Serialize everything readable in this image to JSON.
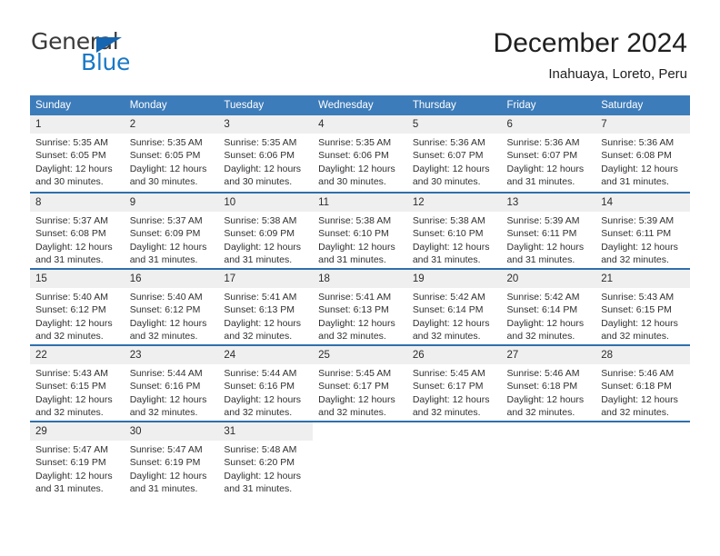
{
  "brand": {
    "name_top": "General",
    "name_bottom": "Blue",
    "flag_color": "#1565b0",
    "text_color": "#3a3a3a",
    "blue_color": "#1878c6"
  },
  "header": {
    "title": "December 2024",
    "location": "Inahuaya, Loreto, Peru"
  },
  "theme": {
    "header_row_bg": "#3d7cba",
    "day_number_bg": "#efefef",
    "row_divider": "#2f6fad"
  },
  "weekdays": [
    "Sunday",
    "Monday",
    "Tuesday",
    "Wednesday",
    "Thursday",
    "Friday",
    "Saturday"
  ],
  "weeks": [
    [
      {
        "day": "1",
        "sunrise": "Sunrise: 5:35 AM",
        "sunset": "Sunset: 6:05 PM",
        "daylight1": "Daylight: 12 hours",
        "daylight2": "and 30 minutes."
      },
      {
        "day": "2",
        "sunrise": "Sunrise: 5:35 AM",
        "sunset": "Sunset: 6:05 PM",
        "daylight1": "Daylight: 12 hours",
        "daylight2": "and 30 minutes."
      },
      {
        "day": "3",
        "sunrise": "Sunrise: 5:35 AM",
        "sunset": "Sunset: 6:06 PM",
        "daylight1": "Daylight: 12 hours",
        "daylight2": "and 30 minutes."
      },
      {
        "day": "4",
        "sunrise": "Sunrise: 5:35 AM",
        "sunset": "Sunset: 6:06 PM",
        "daylight1": "Daylight: 12 hours",
        "daylight2": "and 30 minutes."
      },
      {
        "day": "5",
        "sunrise": "Sunrise: 5:36 AM",
        "sunset": "Sunset: 6:07 PM",
        "daylight1": "Daylight: 12 hours",
        "daylight2": "and 30 minutes."
      },
      {
        "day": "6",
        "sunrise": "Sunrise: 5:36 AM",
        "sunset": "Sunset: 6:07 PM",
        "daylight1": "Daylight: 12 hours",
        "daylight2": "and 31 minutes."
      },
      {
        "day": "7",
        "sunrise": "Sunrise: 5:36 AM",
        "sunset": "Sunset: 6:08 PM",
        "daylight1": "Daylight: 12 hours",
        "daylight2": "and 31 minutes."
      }
    ],
    [
      {
        "day": "8",
        "sunrise": "Sunrise: 5:37 AM",
        "sunset": "Sunset: 6:08 PM",
        "daylight1": "Daylight: 12 hours",
        "daylight2": "and 31 minutes."
      },
      {
        "day": "9",
        "sunrise": "Sunrise: 5:37 AM",
        "sunset": "Sunset: 6:09 PM",
        "daylight1": "Daylight: 12 hours",
        "daylight2": "and 31 minutes."
      },
      {
        "day": "10",
        "sunrise": "Sunrise: 5:38 AM",
        "sunset": "Sunset: 6:09 PM",
        "daylight1": "Daylight: 12 hours",
        "daylight2": "and 31 minutes."
      },
      {
        "day": "11",
        "sunrise": "Sunrise: 5:38 AM",
        "sunset": "Sunset: 6:10 PM",
        "daylight1": "Daylight: 12 hours",
        "daylight2": "and 31 minutes."
      },
      {
        "day": "12",
        "sunrise": "Sunrise: 5:38 AM",
        "sunset": "Sunset: 6:10 PM",
        "daylight1": "Daylight: 12 hours",
        "daylight2": "and 31 minutes."
      },
      {
        "day": "13",
        "sunrise": "Sunrise: 5:39 AM",
        "sunset": "Sunset: 6:11 PM",
        "daylight1": "Daylight: 12 hours",
        "daylight2": "and 31 minutes."
      },
      {
        "day": "14",
        "sunrise": "Sunrise: 5:39 AM",
        "sunset": "Sunset: 6:11 PM",
        "daylight1": "Daylight: 12 hours",
        "daylight2": "and 32 minutes."
      }
    ],
    [
      {
        "day": "15",
        "sunrise": "Sunrise: 5:40 AM",
        "sunset": "Sunset: 6:12 PM",
        "daylight1": "Daylight: 12 hours",
        "daylight2": "and 32 minutes."
      },
      {
        "day": "16",
        "sunrise": "Sunrise: 5:40 AM",
        "sunset": "Sunset: 6:12 PM",
        "daylight1": "Daylight: 12 hours",
        "daylight2": "and 32 minutes."
      },
      {
        "day": "17",
        "sunrise": "Sunrise: 5:41 AM",
        "sunset": "Sunset: 6:13 PM",
        "daylight1": "Daylight: 12 hours",
        "daylight2": "and 32 minutes."
      },
      {
        "day": "18",
        "sunrise": "Sunrise: 5:41 AM",
        "sunset": "Sunset: 6:13 PM",
        "daylight1": "Daylight: 12 hours",
        "daylight2": "and 32 minutes."
      },
      {
        "day": "19",
        "sunrise": "Sunrise: 5:42 AM",
        "sunset": "Sunset: 6:14 PM",
        "daylight1": "Daylight: 12 hours",
        "daylight2": "and 32 minutes."
      },
      {
        "day": "20",
        "sunrise": "Sunrise: 5:42 AM",
        "sunset": "Sunset: 6:14 PM",
        "daylight1": "Daylight: 12 hours",
        "daylight2": "and 32 minutes."
      },
      {
        "day": "21",
        "sunrise": "Sunrise: 5:43 AM",
        "sunset": "Sunset: 6:15 PM",
        "daylight1": "Daylight: 12 hours",
        "daylight2": "and 32 minutes."
      }
    ],
    [
      {
        "day": "22",
        "sunrise": "Sunrise: 5:43 AM",
        "sunset": "Sunset: 6:15 PM",
        "daylight1": "Daylight: 12 hours",
        "daylight2": "and 32 minutes."
      },
      {
        "day": "23",
        "sunrise": "Sunrise: 5:44 AM",
        "sunset": "Sunset: 6:16 PM",
        "daylight1": "Daylight: 12 hours",
        "daylight2": "and 32 minutes."
      },
      {
        "day": "24",
        "sunrise": "Sunrise: 5:44 AM",
        "sunset": "Sunset: 6:16 PM",
        "daylight1": "Daylight: 12 hours",
        "daylight2": "and 32 minutes."
      },
      {
        "day": "25",
        "sunrise": "Sunrise: 5:45 AM",
        "sunset": "Sunset: 6:17 PM",
        "daylight1": "Daylight: 12 hours",
        "daylight2": "and 32 minutes."
      },
      {
        "day": "26",
        "sunrise": "Sunrise: 5:45 AM",
        "sunset": "Sunset: 6:17 PM",
        "daylight1": "Daylight: 12 hours",
        "daylight2": "and 32 minutes."
      },
      {
        "day": "27",
        "sunrise": "Sunrise: 5:46 AM",
        "sunset": "Sunset: 6:18 PM",
        "daylight1": "Daylight: 12 hours",
        "daylight2": "and 32 minutes."
      },
      {
        "day": "28",
        "sunrise": "Sunrise: 5:46 AM",
        "sunset": "Sunset: 6:18 PM",
        "daylight1": "Daylight: 12 hours",
        "daylight2": "and 32 minutes."
      }
    ],
    [
      {
        "day": "29",
        "sunrise": "Sunrise: 5:47 AM",
        "sunset": "Sunset: 6:19 PM",
        "daylight1": "Daylight: 12 hours",
        "daylight2": "and 31 minutes."
      },
      {
        "day": "30",
        "sunrise": "Sunrise: 5:47 AM",
        "sunset": "Sunset: 6:19 PM",
        "daylight1": "Daylight: 12 hours",
        "daylight2": "and 31 minutes."
      },
      {
        "day": "31",
        "sunrise": "Sunrise: 5:48 AM",
        "sunset": "Sunset: 6:20 PM",
        "daylight1": "Daylight: 12 hours",
        "daylight2": "and 31 minutes."
      },
      {
        "day": "",
        "sunrise": "",
        "sunset": "",
        "daylight1": "",
        "daylight2": ""
      },
      {
        "day": "",
        "sunrise": "",
        "sunset": "",
        "daylight1": "",
        "daylight2": ""
      },
      {
        "day": "",
        "sunrise": "",
        "sunset": "",
        "daylight1": "",
        "daylight2": ""
      },
      {
        "day": "",
        "sunrise": "",
        "sunset": "",
        "daylight1": "",
        "daylight2": ""
      }
    ]
  ]
}
